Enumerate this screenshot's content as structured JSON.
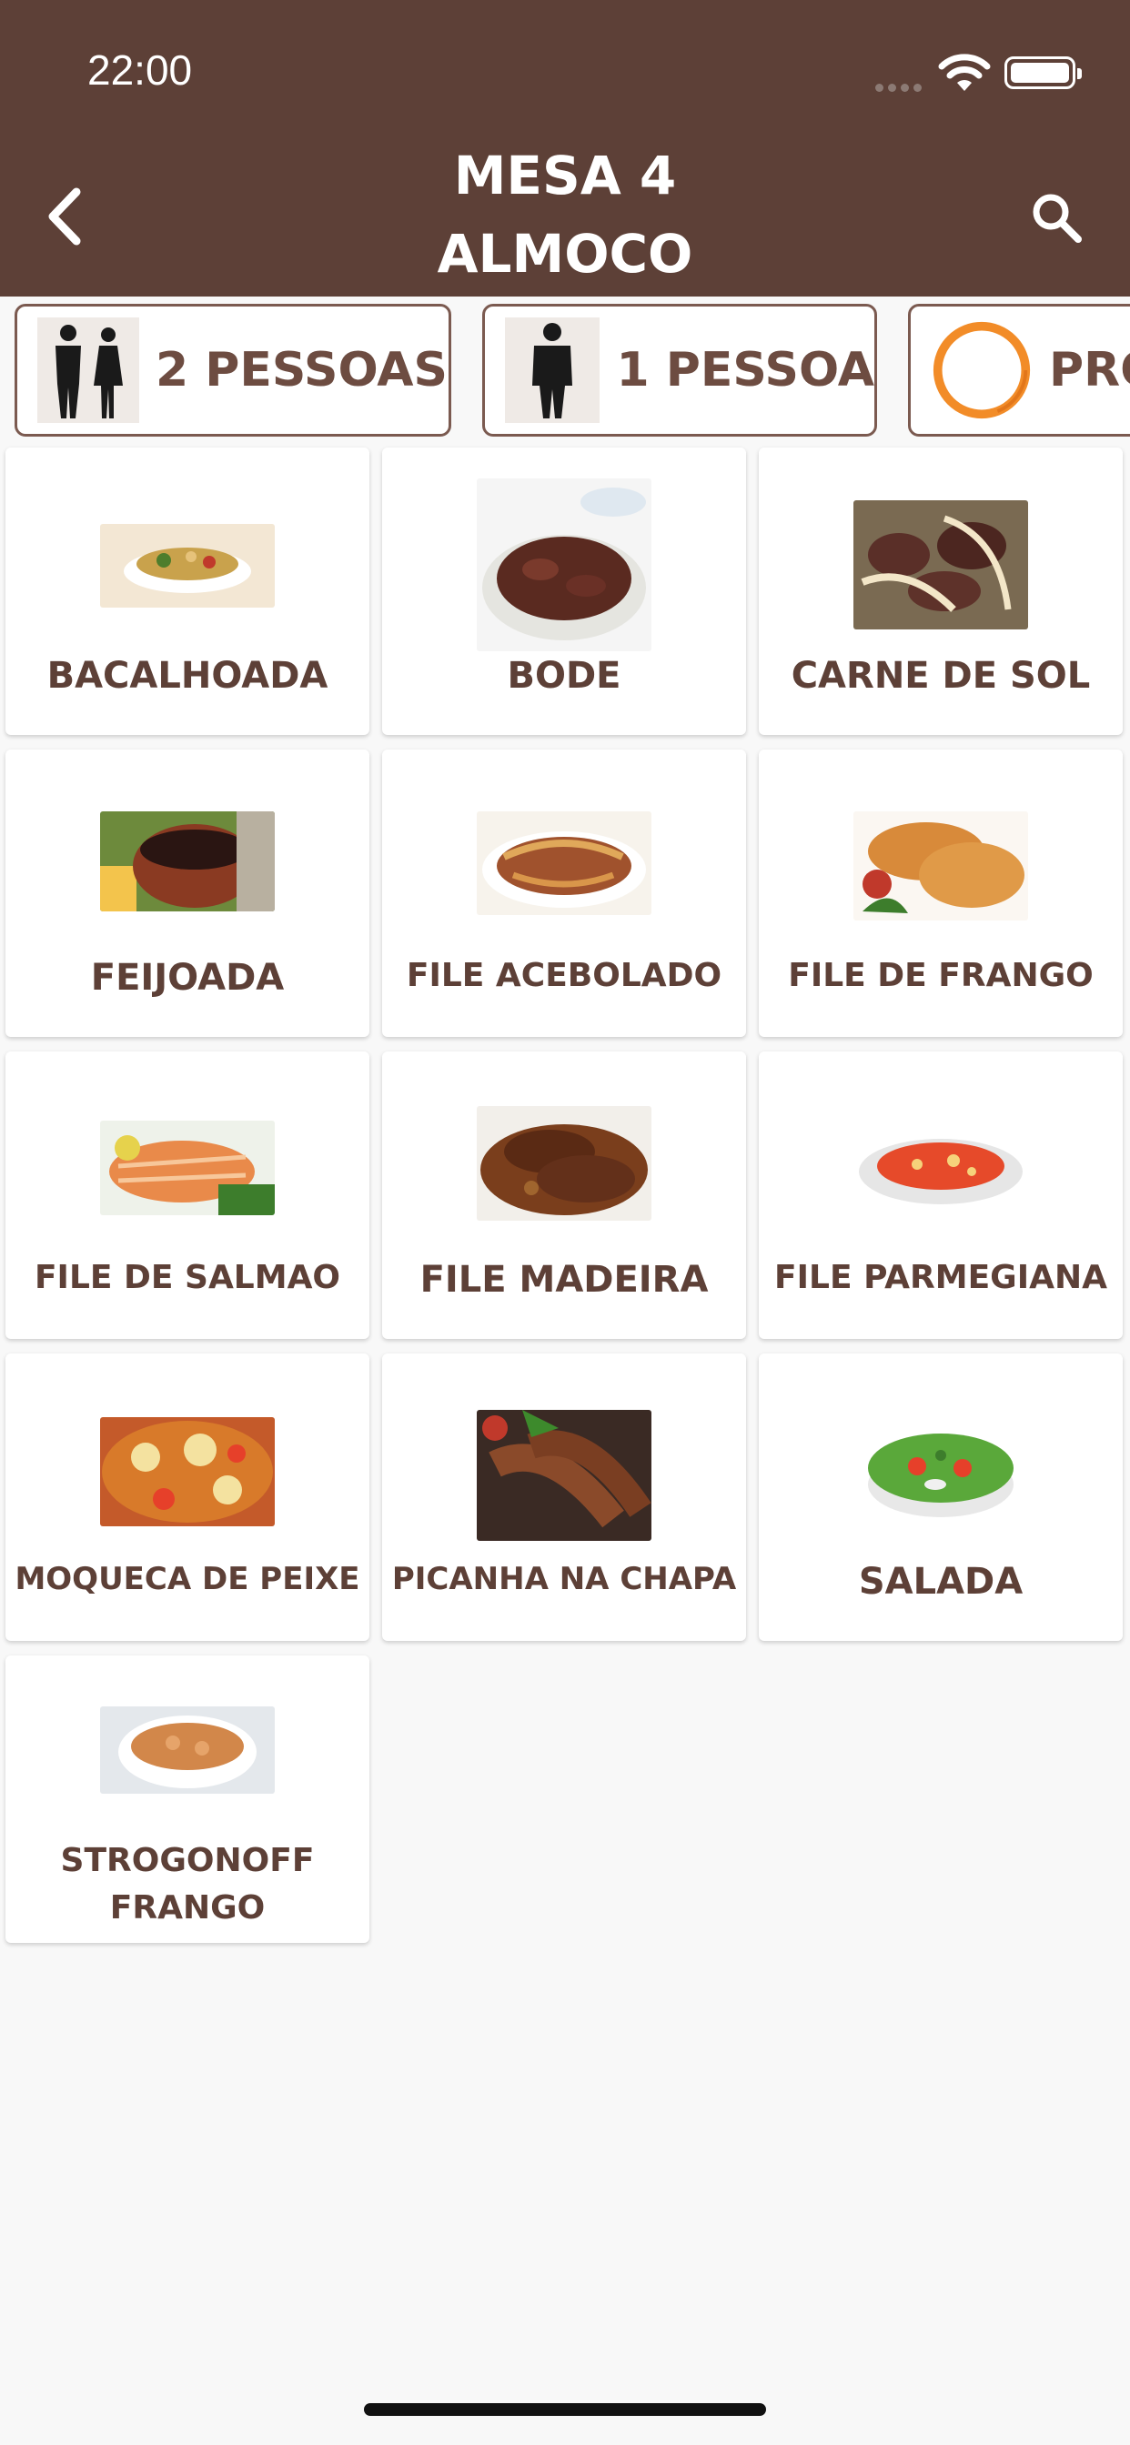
{
  "status_bar": {
    "time": "22:00"
  },
  "header": {
    "title_line1": "MESA 4",
    "title_line2": "ALMOCO"
  },
  "chips": [
    {
      "label": "2 PESSOAS",
      "icon": "two-people-icon"
    },
    {
      "label": "1 PESSOA",
      "icon": "one-person-icon"
    },
    {
      "label": "PRO",
      "icon": "orange-ring-icon"
    }
  ],
  "dishes": [
    {
      "name": "BACALHOADA"
    },
    {
      "name": "BODE"
    },
    {
      "name": "CARNE DE SOL"
    },
    {
      "name": "FEIJOADA"
    },
    {
      "name": "FILE ACEBOLADO"
    },
    {
      "name": "FILE DE FRANGO"
    },
    {
      "name": "FILE DE SALMAO"
    },
    {
      "name": "FILE MADEIRA"
    },
    {
      "name": "FILE PARMEGIANA"
    },
    {
      "name": "MOQUECA DE PEIXE"
    },
    {
      "name": "PICANHA NA CHAPA"
    },
    {
      "name": "SALADA"
    },
    {
      "name": "STROGONOFF FRANGO"
    }
  ],
  "colors": {
    "header": "#5d4037",
    "text": "#5d4037",
    "accent": "#f28c28"
  }
}
